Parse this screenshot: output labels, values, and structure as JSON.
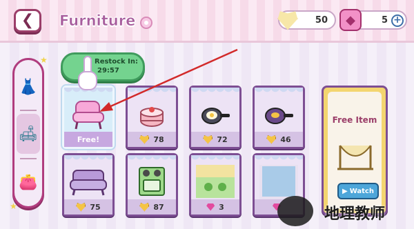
{
  "header": {
    "title": "Furniture",
    "back_icon": "chevron-left-icon",
    "coins": "50",
    "gems": "5",
    "plus_label": "+"
  },
  "restock": {
    "label": "Restock In:",
    "time": "29:57"
  },
  "side_tabs": [
    {
      "name": "clothing-tab",
      "icon": "dress-icon",
      "active": false
    },
    {
      "name": "furniture-tab",
      "icon": "sofa-icon",
      "active": true
    },
    {
      "name": "accessories-tab",
      "icon": "purse-icon",
      "active": false
    }
  ],
  "items": [
    {
      "name": "pink-armchair",
      "price": "Free!",
      "currency": "none",
      "selected": true
    },
    {
      "name": "strawberry-cake",
      "price": "78",
      "currency": "heart"
    },
    {
      "name": "frying-pan-egg",
      "price": "72",
      "currency": "heart"
    },
    {
      "name": "frying-pan-purple",
      "price": "46",
      "currency": "heart"
    },
    {
      "name": "purple-sofa",
      "price": "75",
      "currency": "heart"
    },
    {
      "name": "green-stove",
      "price": "87",
      "currency": "heart"
    },
    {
      "name": "green-rug",
      "price": "3",
      "currency": "gem"
    },
    {
      "name": "blue-frame",
      "price": "",
      "currency": "gem"
    }
  ],
  "featured": {
    "title": "Free Item",
    "watch_label": "Watch"
  },
  "watermark": {
    "text": "地理教师"
  },
  "colors": {
    "accent": "#a75d9d",
    "arrow": "#d22a2a",
    "restock_green": "#74d38f",
    "featured_yellow": "#f3d56f"
  }
}
